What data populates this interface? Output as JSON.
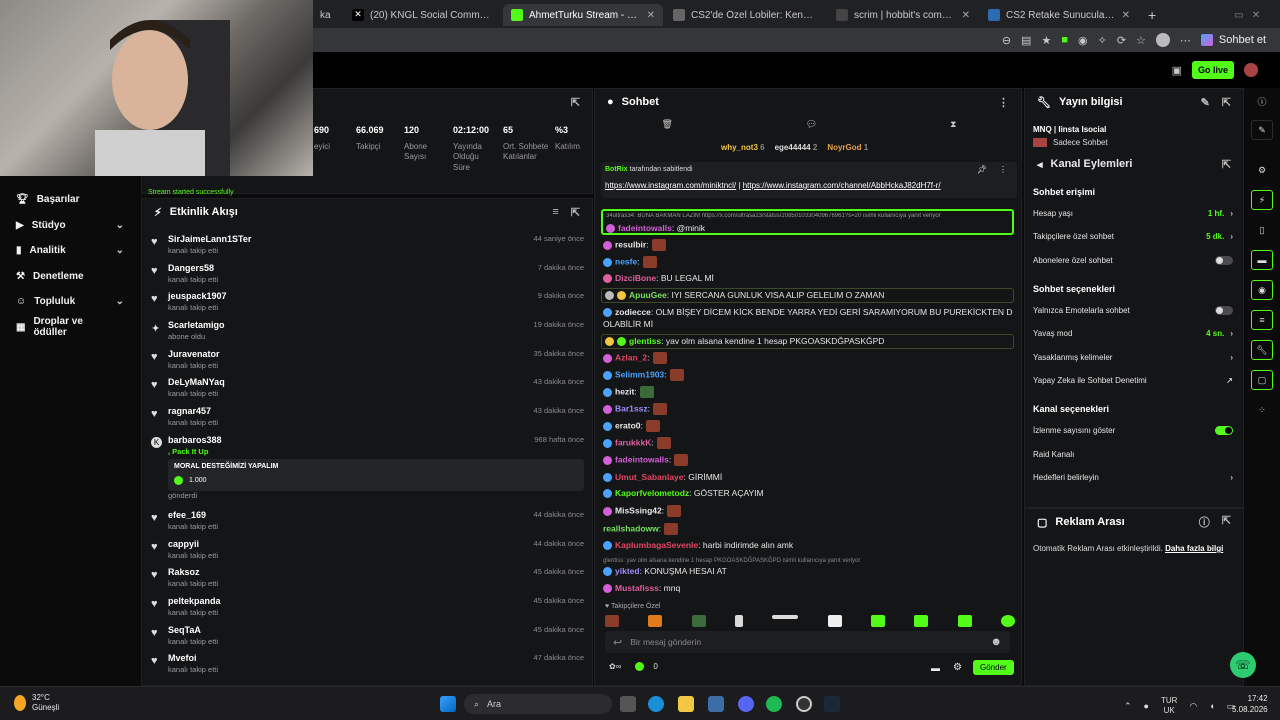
{
  "browser": {
    "tabs": [
      {
        "title": "ka",
        "active": false
      },
      {
        "title": "(20) KNGL Social Community / X",
        "active": false
      },
      {
        "title": "AhmetTurku Stream - Watch Live",
        "active": true
      },
      {
        "title": "CS2'de Özel Lobiler: Kendi Kuralla",
        "active": false
      },
      {
        "title": "scrim | hobbit's community",
        "active": false
      },
      {
        "title": "CS2 Retake Sunucuları – CYBERSH",
        "active": false
      }
    ],
    "profile_label": "Sohbet et"
  },
  "topbar": {
    "golive": "Go live"
  },
  "sidebar": {
    "items": [
      {
        "label": "Başarılar",
        "chev": ""
      },
      {
        "label": "Stüdyo",
        "chev": "⌄"
      },
      {
        "label": "Analitik",
        "chev": "⌄"
      },
      {
        "label": "Denetleme",
        "chev": ""
      },
      {
        "label": "Topluluk",
        "chev": "⌄"
      },
      {
        "label": "Droplar ve ödüller",
        "chev": ""
      }
    ]
  },
  "stats": {
    "items": [
      {
        "value": "690",
        "label": "eyici"
      },
      {
        "value": "66.069",
        "label": "Takipçi"
      },
      {
        "value": "120",
        "label": "Abone Sayısı"
      },
      {
        "value": "02:12:00",
        "label": "Yayında Olduğu Süre"
      },
      {
        "value": "65",
        "label": "Ort. Sohbete Katılanlar"
      },
      {
        "value": "%3",
        "label": "Katılım"
      }
    ],
    "toast": "Stream started successfully"
  },
  "activity": {
    "title": "Etkinlik Akışı",
    "items": [
      {
        "name": "SirJaimeLann1STer",
        "sub": "kanalı takip etti",
        "time": "44 saniye önce",
        "icon": "♥"
      },
      {
        "name": "Dangers58",
        "sub": "kanalı takip etti",
        "time": "7 dakika önce",
        "icon": "♥"
      },
      {
        "name": "jeuspack1907",
        "sub": "kanalı takip etti",
        "time": "9 dakika önce",
        "icon": "♥"
      },
      {
        "name": "Scarletamigo",
        "sub": "abone oldu",
        "time": "19 dakika önce",
        "icon": "✦"
      },
      {
        "name": "Juravenator",
        "sub": "kanalı takip etti",
        "time": "35 dakika önce",
        "icon": "♥"
      },
      {
        "name": "DeLyMaNYaq",
        "sub": "kanalı takip etti",
        "time": "43 dakika önce",
        "icon": "♥"
      },
      {
        "name": "ragnar457",
        "sub": "kanalı takip etti",
        "time": "43 dakika önce",
        "icon": "♥"
      }
    ],
    "special": {
      "name": "barbaros388",
      "sub": ", Pack It Up",
      "time": "968 hafta önce",
      "message": "MORAL DESTEĞİMİZİ YAPALIM",
      "amount": "1.000",
      "sent": "gönderdi"
    },
    "items2": [
      {
        "name": "efee_169",
        "sub": "kanalı takip etti",
        "time": "44 dakika önce"
      },
      {
        "name": "cappyii",
        "sub": "kanalı takip etti",
        "time": "44 dakika önce"
      },
      {
        "name": "Raksoz",
        "sub": "kanalı takip etti",
        "time": "45 dakika önce"
      },
      {
        "name": "peltekpanda",
        "sub": "kanalı takip etti",
        "time": "45 dakika önce"
      },
      {
        "name": "SeqTaA",
        "sub": "kanalı takip etti",
        "time": "45 dakika önce"
      },
      {
        "name": "Mvefoi",
        "sub": "kanalı takip etti",
        "time": "47 dakika önce"
      }
    ]
  },
  "chat": {
    "title": "Sohbet",
    "leaders": [
      {
        "name": "why_not3",
        "n": "6"
      },
      {
        "name": "ege44444",
        "n": "2"
      },
      {
        "name": "NoyrGod",
        "n": "1"
      }
    ],
    "pinned": {
      "by": "BotRix",
      "label": "tarafından sabitlendi",
      "link1": "https://www.instagram.com/miniktncl/",
      "sep": "|",
      "link2": "https://www.instagram.com/channel/AbbHckaJ82dH7f-r/"
    },
    "reply1": "34ultras34: BUNA BAKMAN LAZIM https://x.com/ultrasa23/status/2085010330409676961?s=20 isimli kullanıcıya yanıt veriyor",
    "messages": [
      {
        "user": "fadeintowalls",
        "text": ": @minik",
        "color": "#d35fd9"
      },
      {
        "user": "resulbir",
        "text": ":",
        "color": "#ffffff",
        "emote": true
      },
      {
        "user": "nesfe",
        "text": ":",
        "color": "#4aa3ff",
        "emote": true
      },
      {
        "user": "DizciBone",
        "text": ": BU LEGAL Mİ",
        "color": "#e05fa0"
      },
      {
        "user": "ApuuGee",
        "text": ": IYI SERCANA GUNLUK VISA ALIP GELELIM O ZAMAN",
        "color": "#79e05f"
      },
      {
        "user": "zodiecce",
        "text": ": OLM BİŞEY DİCEM KİCK BENDE YARRA YEDİ GERİ SARAMIYORUM BU PUREKİCKTEN DOLAYI",
        "color": "#ffffff"
      },
      {
        "user": "",
        "text": "OLABİLİR Mİ",
        "color": "#ffffff"
      },
      {
        "user": "glentiss",
        "text": ": yav olm alsana kendine 1 hesap PKGOASKDĞPASKĞPD",
        "color": "#53fc18"
      },
      {
        "user": "Azlan_2",
        "text": ":",
        "color": "#e0475f",
        "emote": true
      },
      {
        "user": "Selimm1903",
        "text": ":",
        "color": "#4aa3ff",
        "emote": true
      },
      {
        "user": "hezit",
        "text": ":",
        "color": "#ffffff",
        "emote": true
      },
      {
        "user": "Bar1ssz",
        "text": ":",
        "color": "#9f8cff",
        "emote": true
      },
      {
        "user": "erato0",
        "text": ":",
        "color": "#ffffff",
        "emote": true
      },
      {
        "user": "farukkkK",
        "text": ":",
        "color": "#e05fa0",
        "emote": true
      },
      {
        "user": "fadeintowalls",
        "text": ":",
        "color": "#d35fd9",
        "emote": true
      },
      {
        "user": "Umut_Sabanlaye",
        "text": ": GİRİMMİ",
        "color": "#e0475f"
      },
      {
        "user": "Kaporfvelometodz",
        "text": ": GÖSTER AÇAYIM",
        "color": "#53fc18"
      },
      {
        "user": "MisSsing42",
        "text": ":",
        "color": "#ffffff",
        "emote": true
      },
      {
        "user": "reallshadoww",
        "text": ":",
        "color": "#79e05f",
        "emote": true
      },
      {
        "user": "KaplumbagaSevenle",
        "text": ": harbi indirimde alın amk",
        "color": "#e0475f"
      }
    ],
    "reply2": "glentiss: yav olm alsana kendine 1 hesap PKGOASKDĞPASKĞPD isimli kullanıcıya yanıt veriyor",
    "messages2": [
      {
        "user": "yikted",
        "text": ": KONUŞMA HESAI AT",
        "color": "#9f8cff"
      },
      {
        "user": "Mustafisss",
        "text": ": mnq",
        "color": "#e05fa0"
      }
    ],
    "emotes_label": "Takipçilere Özel",
    "input_placeholder": "Bir mesaj gönderin",
    "points": "0",
    "send": "Gönder"
  },
  "info": {
    "title": "Yayın bilgisi",
    "stream_title": "MNQ | Iinsta Isocial",
    "category": "Sadece Sohbet",
    "actions_title": "Kanal Eylemleri",
    "sec1": "Sohbet erişimi",
    "rows1": [
      {
        "label": "Hesap yaşı",
        "value": "1 hf."
      },
      {
        "label": "Takipçilere özel sohbet",
        "value": "5 dk."
      },
      {
        "label": "Abonelere özel sohbet",
        "value": ""
      }
    ],
    "sec2": "Sohbet seçenekleri",
    "rows2": [
      {
        "label": "Yalnızca Emotelarla sohbet",
        "value": ""
      },
      {
        "label": "Yavaş mod",
        "value": "4 sn."
      },
      {
        "label": "Yasaklanmış kelimeler",
        "value": ""
      },
      {
        "label": "Yapay Zeka ile Sohbet Denetimi",
        "value": ""
      }
    ],
    "sec3": "Kanal seçenekleri",
    "rows3": [
      {
        "label": "İzlenme sayısını göster",
        "value": ""
      },
      {
        "label": "Raid Kanalı",
        "value": ""
      },
      {
        "label": "Hedefleri belirleyin",
        "value": ""
      }
    ]
  },
  "ads": {
    "title": "Reklam Arası",
    "text": "Otomatik Reklam Arası etkinleştirildi.",
    "link": "Daha fazla bilgi"
  },
  "taskbar": {
    "temp": "32°C",
    "weather": "Güneşli",
    "search": "Ara",
    "lang1": "TUR",
    "lang2": "UK",
    "time": "17:42",
    "date": "5.08.2026"
  }
}
